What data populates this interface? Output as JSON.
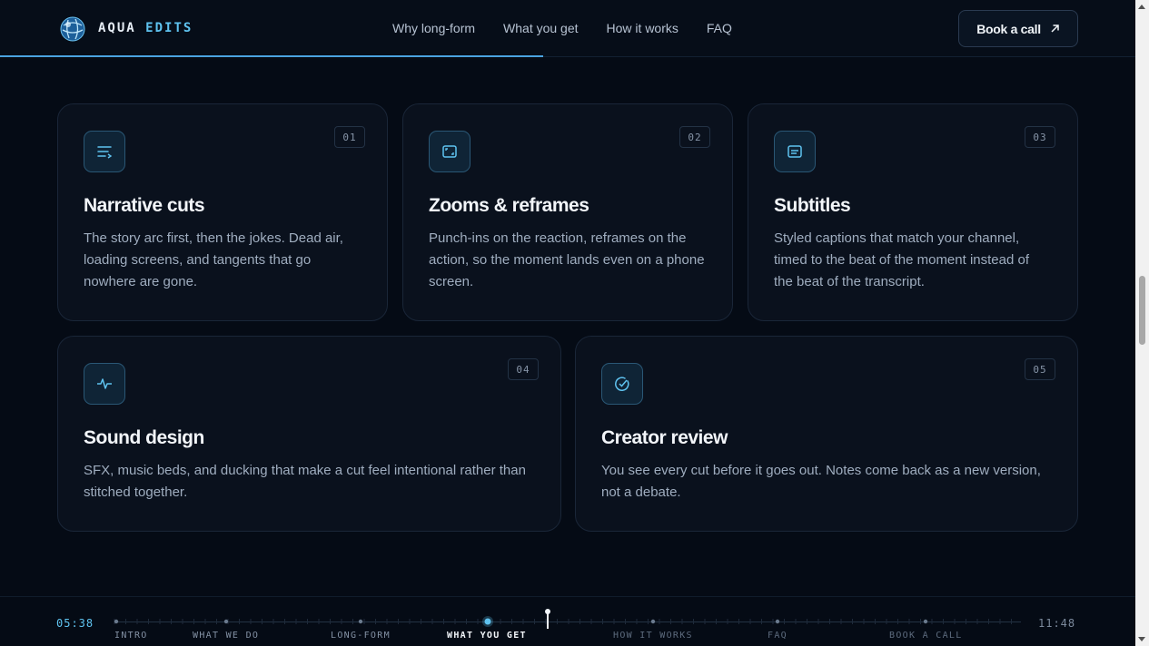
{
  "header": {
    "brand_part1": "AQUA",
    "brand_part2": "EDITS",
    "nav": [
      "Why long-form",
      "What you get",
      "How it works",
      "FAQ"
    ],
    "cta_label": "Book a call",
    "cta_icon": "arrow-up-right-icon"
  },
  "cards": [
    {
      "num": "01",
      "title": "Narrative cuts",
      "icon": "list-arrow-icon",
      "text": "The story arc first, then the jokes. Dead air, loading screens, and tangents that go nowhere are gone."
    },
    {
      "num": "02",
      "title": "Zooms & reframes",
      "icon": "reframe-icon",
      "text": "Punch-ins on the reaction, reframes on the action, so the moment lands even on a phone screen."
    },
    {
      "num": "03",
      "title": "Subtitles",
      "icon": "caption-icon",
      "text": "Styled captions that match your channel, timed to the beat of the moment instead of the beat of the transcript."
    },
    {
      "num": "04",
      "title": "Sound design",
      "icon": "waveform-icon",
      "text": "SFX, music beds, and ducking that make a cut feel intentional rather than stitched together."
    },
    {
      "num": "05",
      "title": "Creator review",
      "icon": "check-circle-icon",
      "text": "You see every cut before it goes out. Notes come back as a new version, not a debate."
    }
  ],
  "timeline": {
    "start_time": "05:38",
    "end_time": "11:48",
    "sections": [
      "INTRO",
      "WHAT WE DO",
      "LONG-FORM",
      "WHAT YOU GET",
      "HOW IT WORKS",
      "FAQ",
      "BOOK A CALL"
    ],
    "active_section": "WHAT YOU GET"
  },
  "colors": {
    "accent": "#5fc3f0",
    "background": "#050b15",
    "card_bg": "#0a111d"
  }
}
